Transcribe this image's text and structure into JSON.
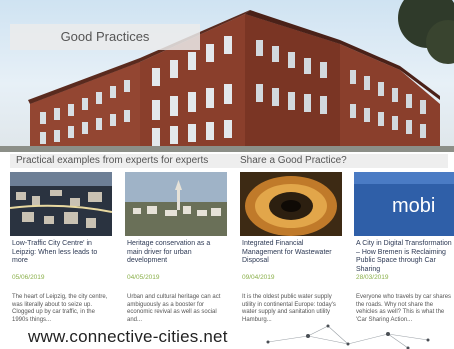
{
  "header": {
    "title": "Good Practices"
  },
  "tagbar": {
    "left_label": "Practical examples from experts for experts",
    "right_label": "Share a Good Practice?"
  },
  "cards": [
    {
      "title": "Low-Traffic City Centre' in Leipzig: When less leads to more",
      "date": "05/06/2019",
      "description": "The heart of Leipzig, the city centre, was literally about to seize up. Clogged up by car traffic, in the 1990s things..."
    },
    {
      "title": "Heritage conservation as a main driver for urban development",
      "date": "04/05/2019",
      "description": "Urban and cultural heritage can act ambiguously as a booster for economic revival as well as social and..."
    },
    {
      "title": "Integrated Financial Management for Wastewater Disposal",
      "date": "09/04/2019",
      "description": "It is the oldest public water supply utility in continental Europe: today's water supply and sanitation utility Hamburg..."
    },
    {
      "title": "A City in Digital Transformation – How Bremen is Reclaiming Public Space through Car Sharing",
      "date": "28/03/2019",
      "description": "Everyone who travels by car shares the roads. Why not share the vehicles as well? This is what the 'Car Sharing Action..."
    }
  ],
  "card_thumb_text": {
    "mobility_sign": "mobi"
  },
  "footer": {
    "url": "www.connective-cities.net"
  },
  "colors": {
    "date_green": "#8ab04a",
    "title_navy": "#2e3a55",
    "tagbar_bg": "#eeeeee"
  }
}
